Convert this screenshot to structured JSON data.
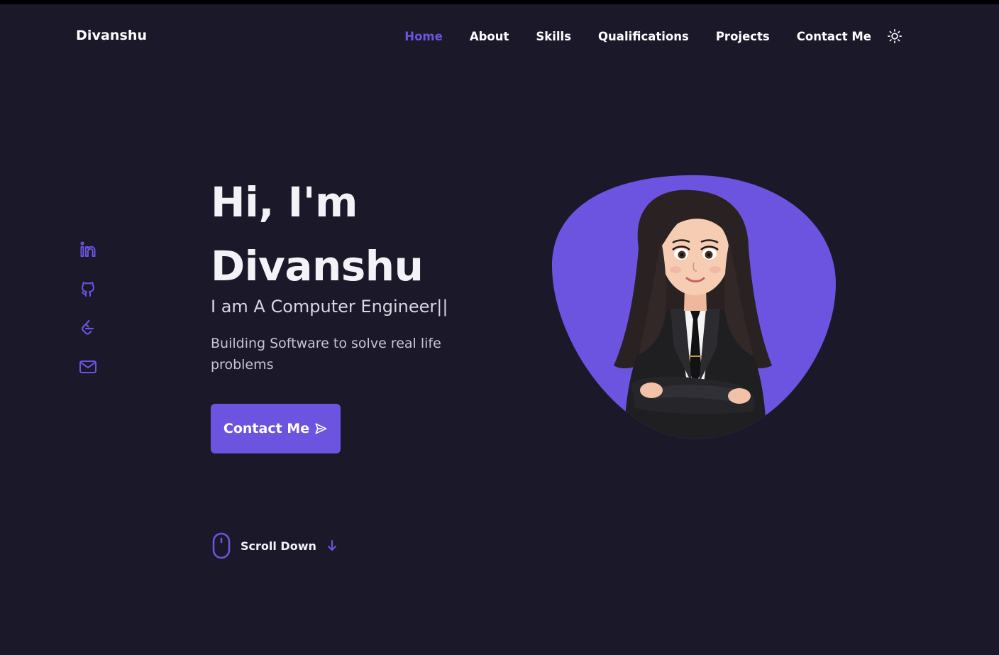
{
  "header": {
    "brand": "Divanshu",
    "nav": [
      {
        "label": "Home",
        "active": true
      },
      {
        "label": "About",
        "active": false
      },
      {
        "label": "Skills",
        "active": false
      },
      {
        "label": "Qualifications",
        "active": false
      },
      {
        "label": "Projects",
        "active": false
      },
      {
        "label": "Contact Me",
        "active": false
      }
    ],
    "theme_toggle_icon": "sun-icon"
  },
  "social": [
    {
      "icon": "linkedin-icon"
    },
    {
      "icon": "github-icon"
    },
    {
      "icon": "leetcode-icon"
    },
    {
      "icon": "mail-icon"
    }
  ],
  "hero": {
    "title_line1": "Hi, I'm",
    "title_line2": "Divanshu",
    "subtitle": "I am A Computer Engineer||",
    "description": "Building Software to solve real life problems",
    "cta_label": "Contact Me",
    "cta_icon": "send-icon",
    "avatar": "avatar-illustration"
  },
  "scroll": {
    "label": "Scroll Down",
    "mouse_icon": "mouse-icon",
    "arrow_icon": "arrow-down-icon"
  },
  "colors": {
    "background": "#1b1829",
    "accent": "#6c54e0",
    "text": "#ffffff"
  }
}
